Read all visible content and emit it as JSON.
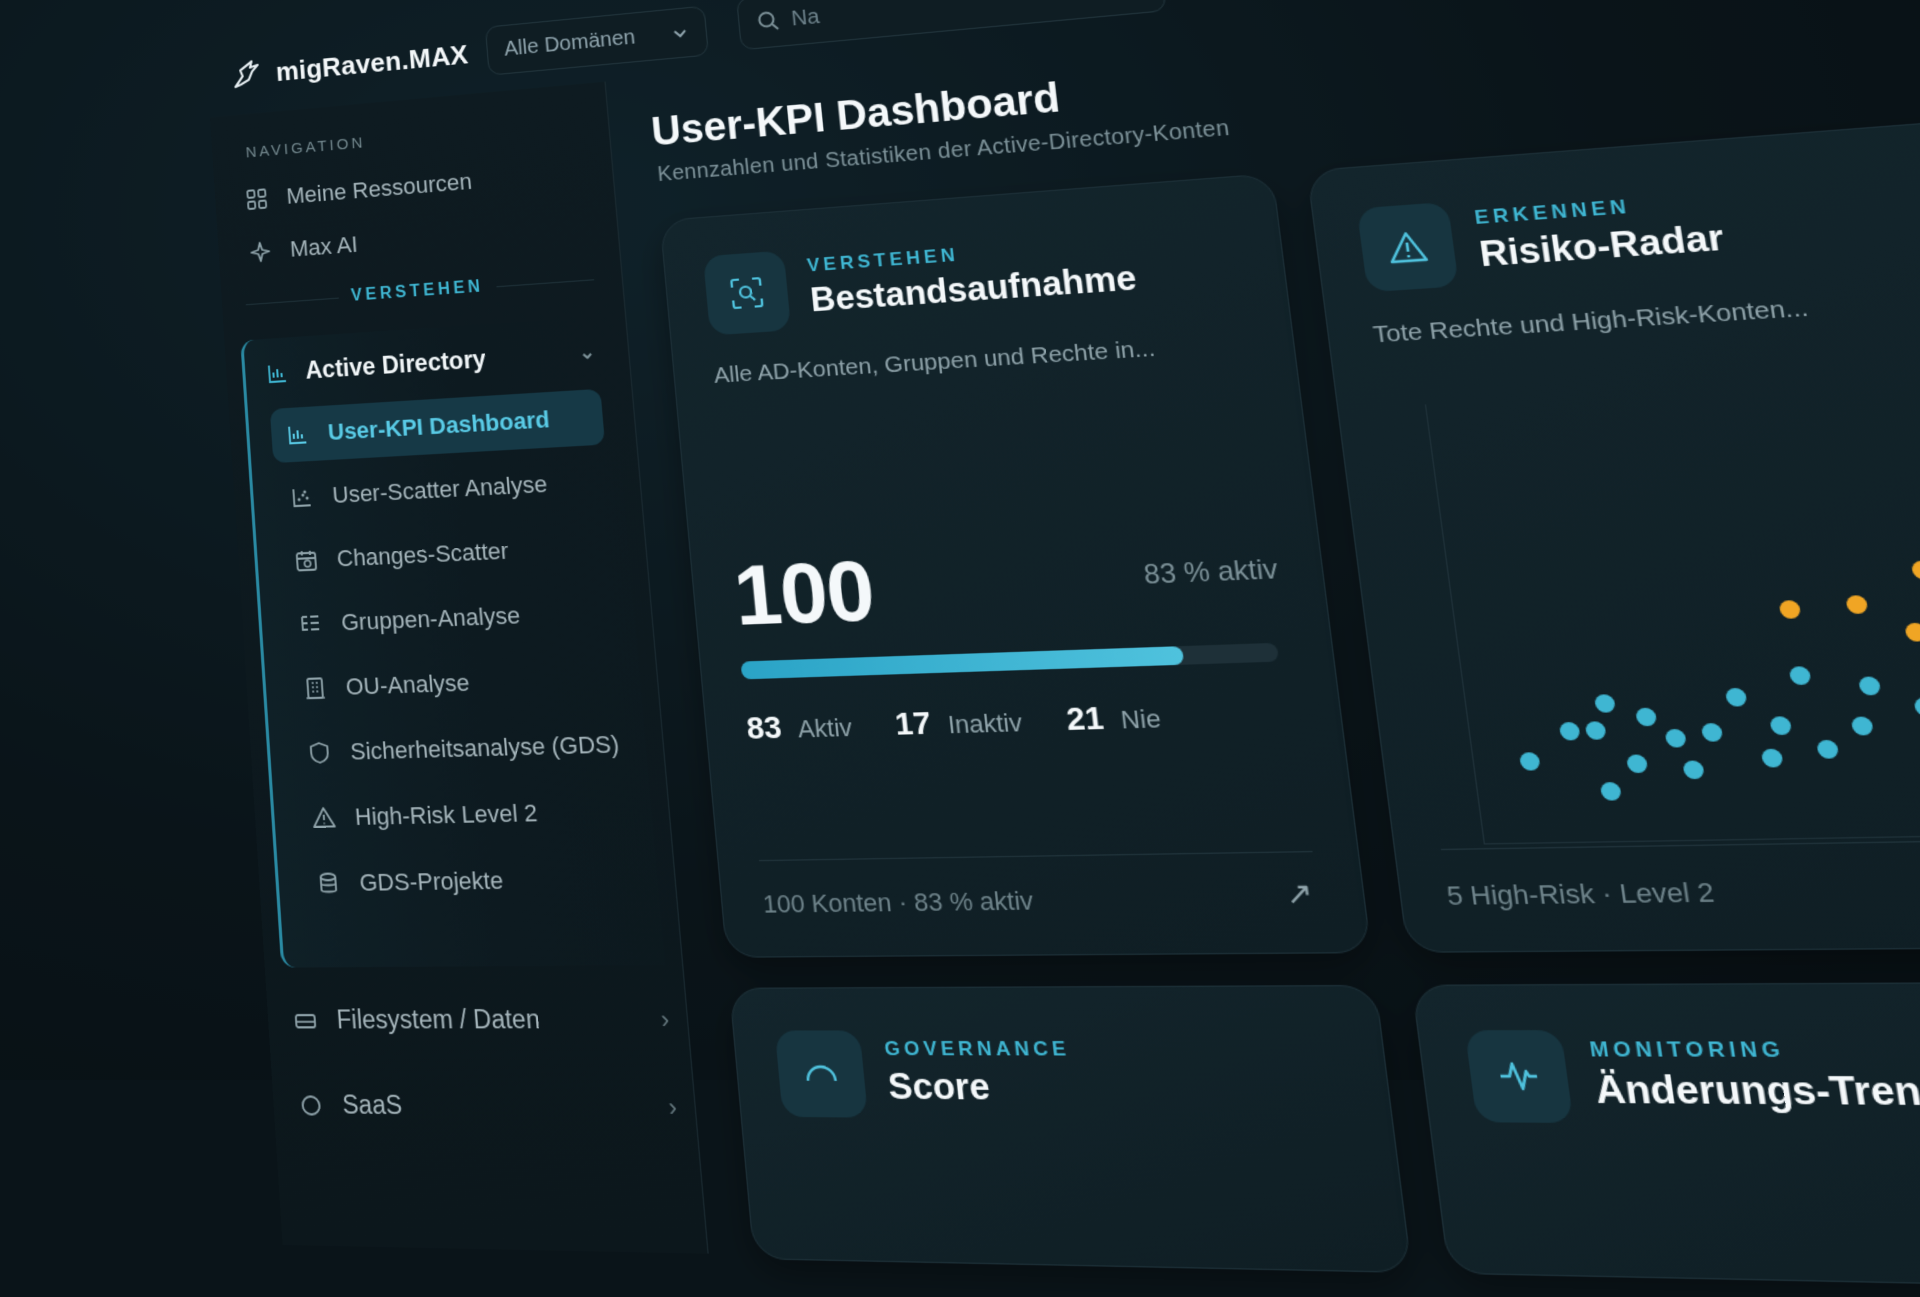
{
  "brand": {
    "name": "migRaven.MAX"
  },
  "topbar": {
    "domain_select": "Alle Domänen",
    "search_placeholder": "Na"
  },
  "sidebar": {
    "nav_heading": "NAVIGATION",
    "nav_items": [
      {
        "label": "Meine Ressourcen",
        "icon": "grid-icon"
      },
      {
        "label": "Max AI",
        "icon": "sparkle-icon"
      }
    ],
    "section_label": "VERSTEHEN",
    "group": {
      "label": "Active Directory",
      "items": [
        {
          "label": "User-KPI Dashboard",
          "icon": "bar-chart-icon",
          "active": true
        },
        {
          "label": "User-Scatter Analyse",
          "icon": "scatter-icon"
        },
        {
          "label": "Changes-Scatter",
          "icon": "calendar-icon"
        },
        {
          "label": "Gruppen-Analyse",
          "icon": "list-tree-icon"
        },
        {
          "label": "OU-Analyse",
          "icon": "building-icon"
        },
        {
          "label": "Sicherheitsanalyse (GDS)",
          "icon": "shield-icon"
        },
        {
          "label": "High-Risk Level 2",
          "icon": "warning-icon"
        },
        {
          "label": "GDS-Projekte",
          "icon": "database-icon"
        }
      ]
    },
    "collapsed": [
      {
        "label": "Filesystem / Daten",
        "icon": "drive-icon"
      },
      {
        "label": "SaaS",
        "icon": "cloud-icon"
      }
    ]
  },
  "main": {
    "title": "User-KPI Dashboard",
    "subtitle": "Kennzahlen und Statistiken der Active-Directory-Konten"
  },
  "cards": {
    "inventory": {
      "tag": "VERSTEHEN",
      "title": "Bestandsaufnahme",
      "desc": "Alle AD-Konten, Gruppen und Rechte in...",
      "total": "100",
      "active_pct_label": "83 % aktiv",
      "active_fraction": 0.83,
      "stats": [
        {
          "num": "83",
          "label": "Aktiv"
        },
        {
          "num": "17",
          "label": "Inaktiv"
        },
        {
          "num": "21",
          "label": "Nie"
        }
      ],
      "footer": "100 Konten · 83 % aktiv",
      "arrow": "↗"
    },
    "risk": {
      "tag": "ERKENNEN",
      "title": "Risiko-Radar",
      "desc": "Tote Rechte und High-Risk-Konten...",
      "footer": "5 High-Risk · Level 2",
      "colors": {
        "low": "#3fb6d2",
        "mid": "#f0a524",
        "high": "#e2383d"
      }
    },
    "governance": {
      "tag": "GOVERNANCE",
      "title": "Score"
    },
    "monitoring": {
      "tag": "MONITORING",
      "title": "Änderungs-Trend"
    }
  }
}
